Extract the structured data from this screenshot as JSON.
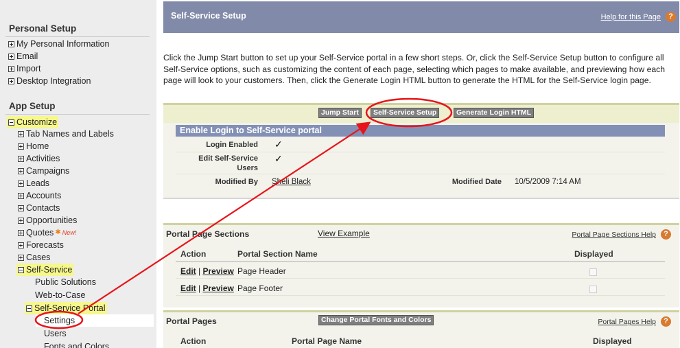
{
  "sidebar": {
    "personal_heading": "Personal Setup",
    "personal_items": [
      "My Personal Information",
      "Email",
      "Import",
      "Desktop Integration"
    ],
    "app_heading": "App Setup",
    "customize": "Customize",
    "customize_items": [
      "Tab Names and Labels",
      "Home",
      "Activities",
      "Campaigns",
      "Leads",
      "Accounts",
      "Contacts",
      "Opportunities",
      "Quotes",
      "Forecasts",
      "Cases"
    ],
    "quotes_new_badge": "New!",
    "self_service": "Self-Service",
    "self_service_items": [
      "Public Solutions",
      "Web-to-Case"
    ],
    "portal": "Self-Service Portal",
    "portal_items": [
      "Settings",
      "Users",
      "Fonts and Colors"
    ]
  },
  "header": {
    "title": "Self-Service Setup",
    "help_link": "Help for this Page",
    "help_icon": "?"
  },
  "intro": "Click the Jump Start button to set up your Self-Service portal in a few short steps. Or, click the Self-Service Setup button to configure all Self-Service options, such as customizing the content of each page, selecting which pages to make available, and previewing how each page will look to your customers. Then, click the Generate Login HTML button to generate the HTML for the Self-Service login page.",
  "setup": {
    "buttons": [
      "Jump Start",
      "Self-Service Setup",
      "Generate Login HTML"
    ],
    "section_title": "Enable Login to Self-Service portal",
    "login_enabled_label": "Login Enabled",
    "login_enabled_value": "✓",
    "edit_users_label_1": "Edit Self-Service",
    "edit_users_label_2": "Users",
    "edit_users_value": "✓",
    "modified_by_label": "Modified By",
    "modified_by_value": "Sheli Black",
    "modified_date_label": "Modified Date",
    "modified_date_value": "10/5/2009 7:14 AM"
  },
  "sections_panel": {
    "title": "Portal Page Sections",
    "view_example": "View Example",
    "help_link": "Portal Page Sections Help",
    "columns": [
      "Action",
      "Portal Section Name",
      "Displayed"
    ],
    "rows": [
      {
        "edit": "Edit",
        "sep": "|",
        "preview": "Preview",
        "name": "Page Header"
      },
      {
        "edit": "Edit",
        "sep": "|",
        "preview": "Preview",
        "name": "Page Footer"
      }
    ]
  },
  "pages_panel": {
    "title": "Portal Pages",
    "button": "Change Portal Fonts and Colors",
    "help_link": "Portal Pages Help",
    "columns": [
      "Action",
      "Portal Page Name",
      "Displayed"
    ]
  },
  "colors": {
    "header_bg": "#818aa9",
    "section_header_bg": "#8390b6",
    "highlight": "#f6f78c",
    "annotation_red": "#e8141b"
  }
}
